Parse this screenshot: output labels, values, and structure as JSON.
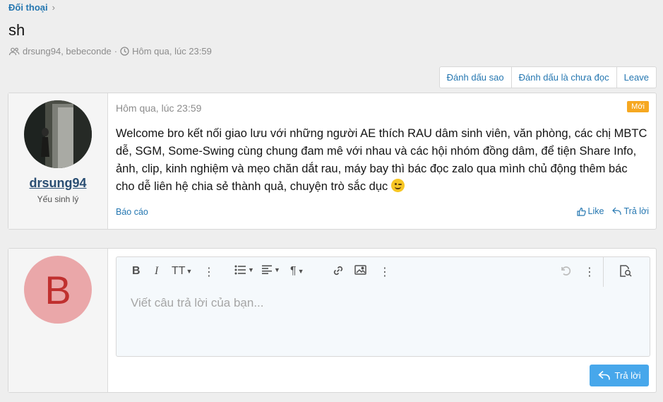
{
  "breadcrumb": {
    "label": "Đối thoại"
  },
  "page": {
    "title": "sh",
    "participants": "drsung94, bebeconde",
    "separator": "·",
    "date": "Hôm qua, lúc 23:59"
  },
  "actions": {
    "star": "Đánh dấu sao",
    "unread": "Đánh dấu là chưa đọc",
    "leave": "Leave"
  },
  "message": {
    "username": "drsung94",
    "user_title": "Yếu sinh lý",
    "time": "Hôm qua, lúc 23:59",
    "badge": "Mới",
    "body": "Welcome bro kết nối giao lưu với những người AE thích RAU dâm sinh viên, văn phòng, các chị MBTC dễ, SGM, Some-Swing cùng chung đam mê với nhau và các hội nhóm đồng dâm, để tiện Share Info, ảnh, clip, kinh nghiệm và mẹo chăn dắt rau, máy bay thì bác đọc zalo qua mình chủ động thêm bác cho dễ liên hệ chia sẻ thành quả, chuyện trò sắc dục",
    "report": "Báo cáo",
    "like": "Like",
    "reply": "Trả lời"
  },
  "reply_box": {
    "avatar_letter": "B",
    "placeholder": "Viết câu trả lời của bạn...",
    "submit": "Trả lời",
    "toolbar": {
      "bold": "B",
      "italic": "I",
      "text_size": "TT",
      "more": "⋮"
    }
  },
  "colors": {
    "link": "#2577b1",
    "badge": "#f6a821",
    "primary_button": "#47a7eb",
    "avatar_bg": "#eaa7a9",
    "avatar_letter": "#c0302f"
  }
}
